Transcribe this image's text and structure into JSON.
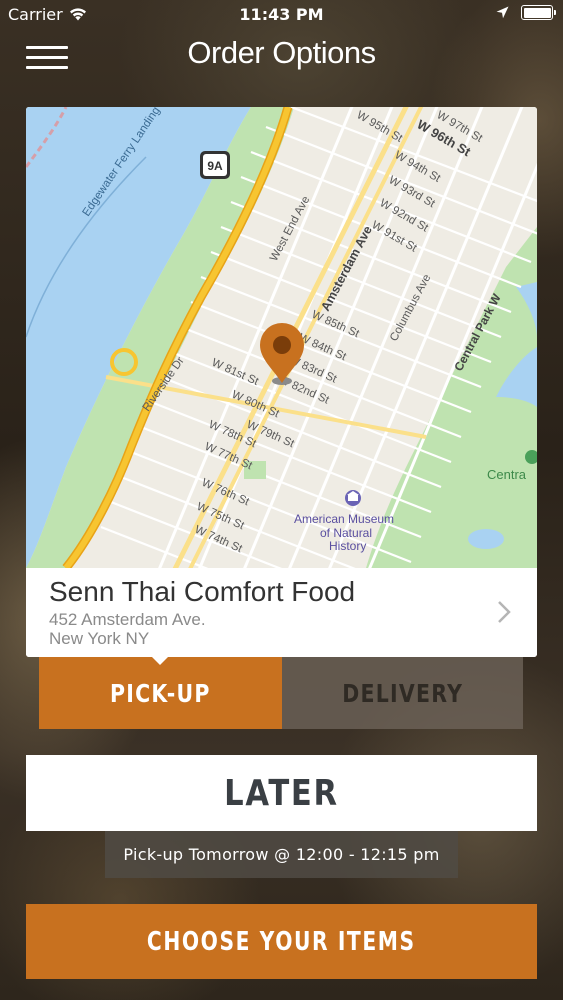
{
  "status_bar": {
    "carrier": "Carrier",
    "time": "11:43 PM"
  },
  "header": {
    "title": "Order Options"
  },
  "map": {
    "highway_shield": "9A",
    "labels": {
      "edgewater": "Edgewater Ferry Landing",
      "w96": "W 96th St",
      "w95": "W 95th St",
      "w97": "W 97th St",
      "w94": "W 94th St",
      "w93": "W 93rd St",
      "w92": "W 92nd St",
      "w91": "W 91st St",
      "west_end": "West End Ave",
      "amsterdam": "Amsterdam Ave",
      "columbus": "Columbus Ave",
      "central_park_w": "Central Park W",
      "w85": "W 85th St",
      "w84": "W 84th St",
      "w83": "W 83rd St",
      "w82": "W 82nd St",
      "w81": "W 81st St",
      "w80": "W 80th St",
      "w79": "W 79th St",
      "w78": "W 78th St",
      "w77": "W 77th St",
      "w76": "W 76th St",
      "w75": "W 75th St",
      "w74": "W 74th St",
      "riverside": "Riverside Dr",
      "museum1": "American Museum",
      "museum2": "of Natural",
      "museum3": "History",
      "central": "Centra"
    }
  },
  "store": {
    "name": "Senn Thai Comfort Food",
    "address_line1": "452 Amsterdam Ave.",
    "address_line2": "New York NY"
  },
  "tabs": {
    "pickup": "PICK-UP",
    "delivery": "DELIVERY",
    "selected": "pickup"
  },
  "schedule": {
    "later_label": "LATER",
    "pickup_time": "Pick-up Tomorrow @ 12:00 - 12:15 pm"
  },
  "cta": {
    "label": "CHOOSE YOUR ITEMS"
  },
  "colors": {
    "accent": "#c8711f",
    "map_water": "#a9d2f2",
    "map_park": "#bfe3b0",
    "map_highway": "#f7c531"
  }
}
